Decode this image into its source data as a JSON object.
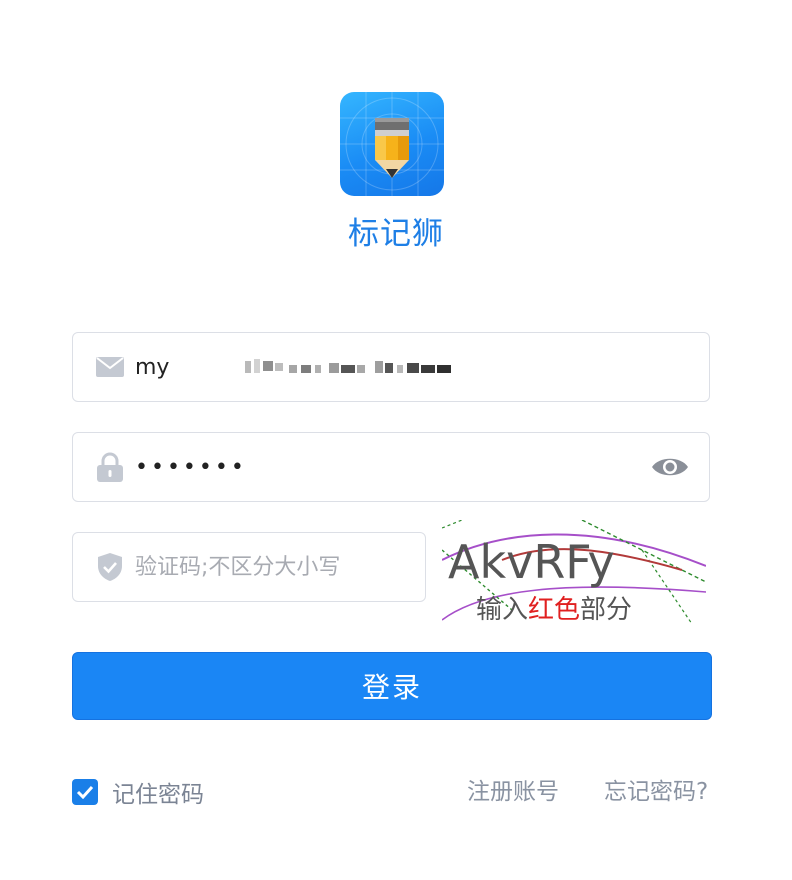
{
  "app": {
    "name": "标记狮"
  },
  "form": {
    "email": {
      "value": "my",
      "icon": "mail-icon"
    },
    "password": {
      "value": "•••••••",
      "icon": "lock-icon",
      "toggle_icon": "eye-icon"
    },
    "captcha": {
      "placeholder": "验证码;不区分大小写",
      "icon": "shield-icon",
      "image_text": "AkvRFy",
      "hint_prefix": "输入",
      "hint_highlight": "红色",
      "hint_suffix": "部分"
    },
    "login_label": "登录"
  },
  "footer": {
    "remember_label": "记住密码",
    "remember_checked": true,
    "register_label": "注册账号",
    "forgot_label": "忘记密码?"
  },
  "colors": {
    "primary": "#1a86f5",
    "brand_text": "#1e7fe6",
    "muted_text": "#8a93a2",
    "border": "#dcdfe6"
  }
}
